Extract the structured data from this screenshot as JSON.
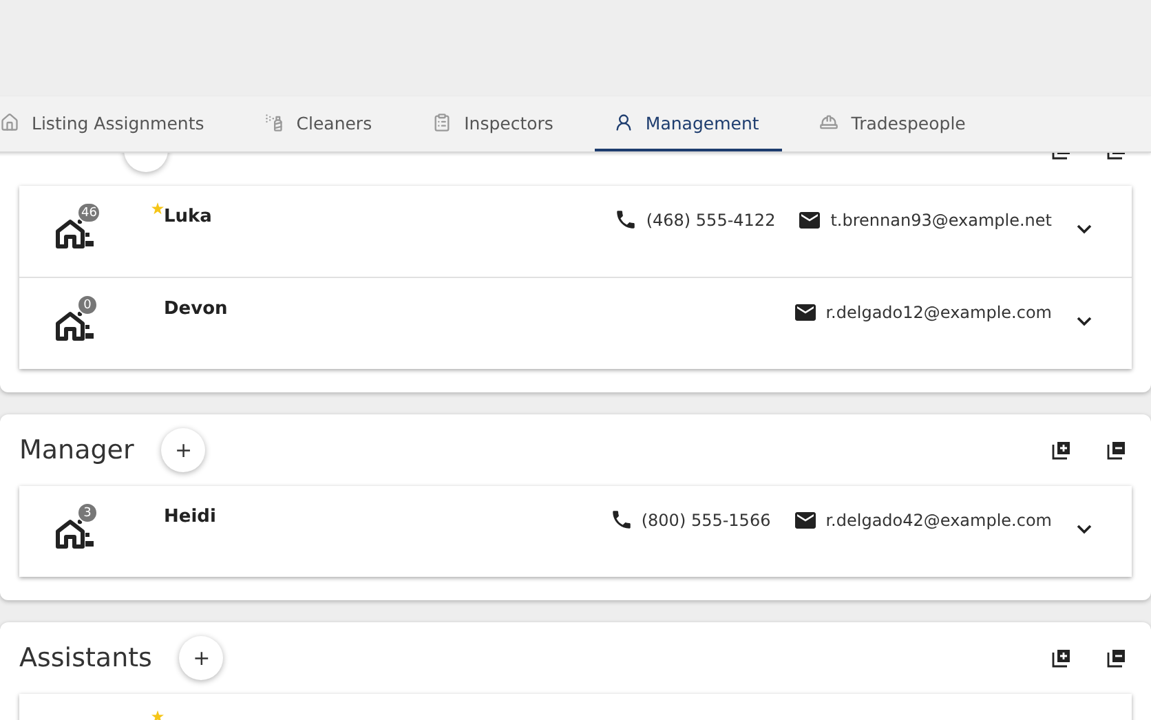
{
  "tabs": [
    {
      "label": "Listing Assignments",
      "kind": "listing",
      "selected": false
    },
    {
      "label": "Cleaners",
      "kind": "cleaners",
      "selected": false
    },
    {
      "label": "Inspectors",
      "kind": "inspectors",
      "selected": false
    },
    {
      "label": "Management",
      "kind": "management",
      "selected": true
    },
    {
      "label": "Tradespeople",
      "kind": "trades",
      "selected": false
    }
  ],
  "sections": [
    {
      "entries": [
        {
          "name": "Luka",
          "starred": true,
          "listings": "46",
          "phone": "(468) 555-4122",
          "email": "t.brennan93@example.net"
        },
        {
          "name": "Devon",
          "starred": false,
          "listings": "0",
          "email": "r.delgado12@example.com"
        }
      ]
    },
    {
      "title": "Manager",
      "add_button": "+",
      "entries": [
        {
          "name": "Heidi",
          "starred": false,
          "listings": "3",
          "phone": "(800) 555-1566",
          "email": "r.delgado42@example.com"
        }
      ]
    },
    {
      "title": "Assistants",
      "add_button": "+",
      "entries": [
        {
          "starred": true
        }
      ]
    }
  ]
}
